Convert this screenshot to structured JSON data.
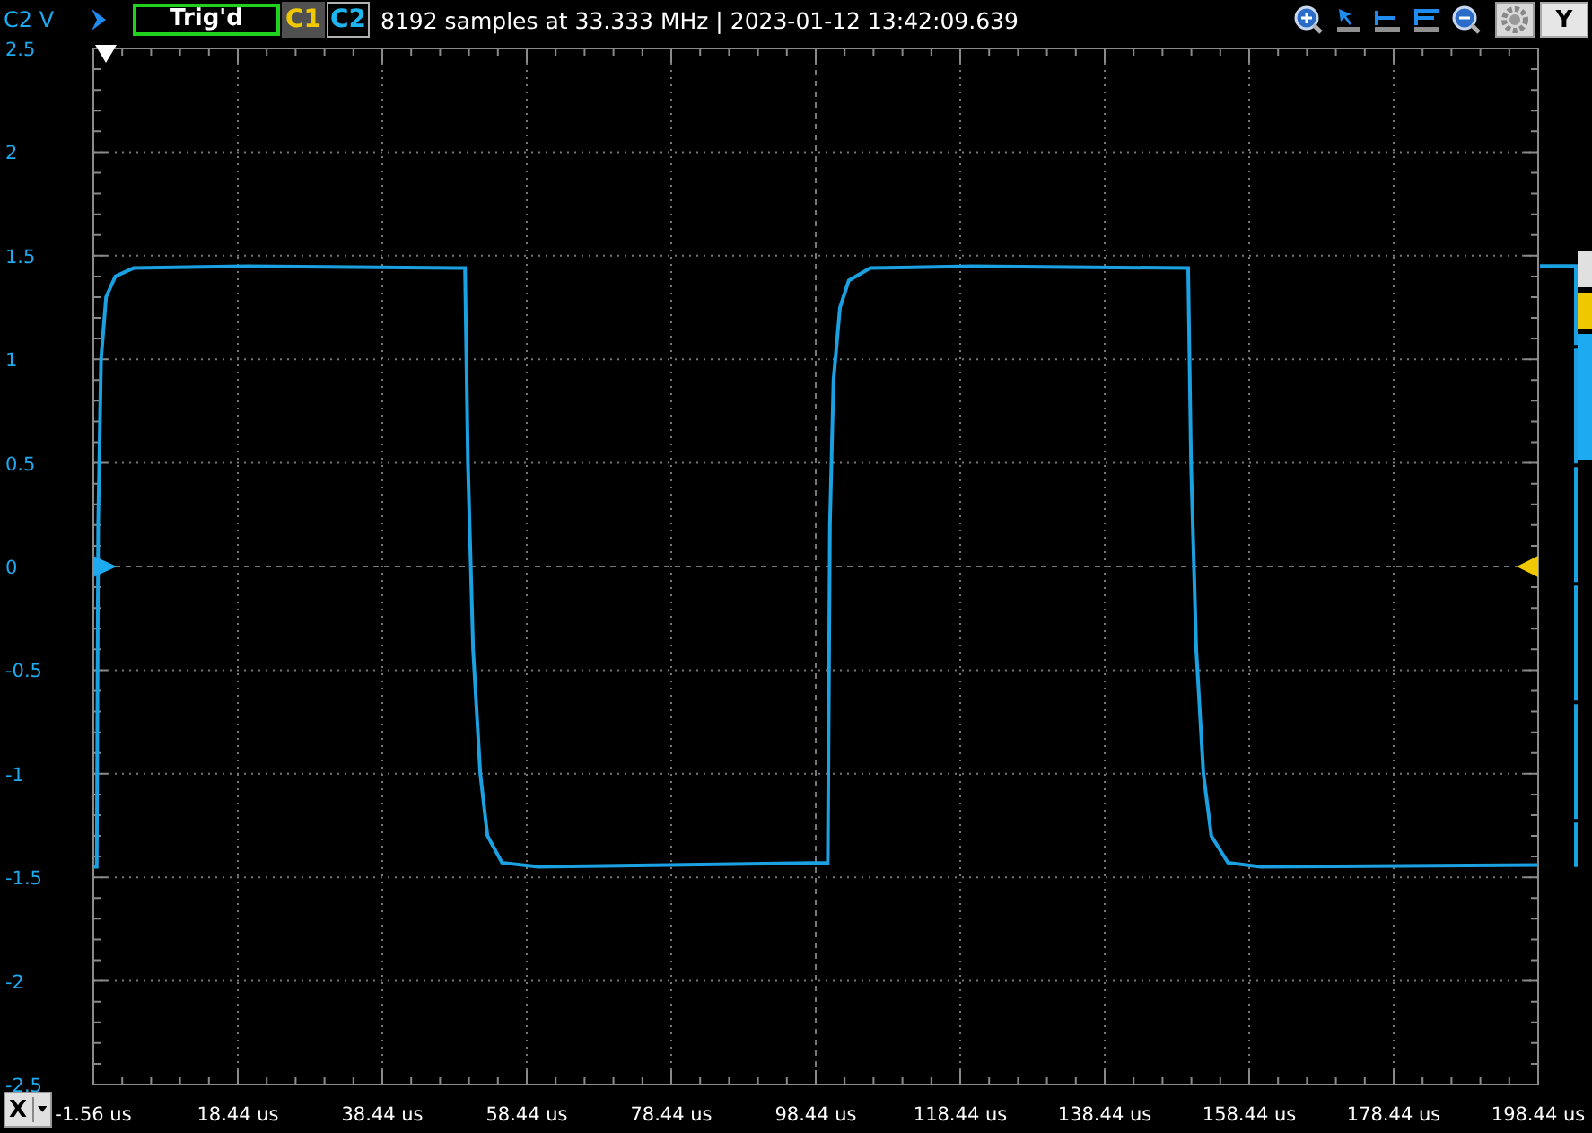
{
  "channel_label": "C2 V",
  "status": "Trig'd",
  "channels": [
    {
      "label": "C1",
      "selected": false,
      "color": "#f0c800"
    },
    {
      "label": "C2",
      "selected": true,
      "color": "#1eb4f0"
    }
  ],
  "info": "8192 samples at 33.333 MHz | 2023-01-12 13:42:09.639",
  "y_button": "Y",
  "x_button": "X",
  "chart_data": {
    "type": "line",
    "grid": true,
    "xlim": [
      -1.56,
      198.44
    ],
    "ylim": [
      -2.5,
      2.5
    ],
    "x": [
      -1.56,
      -1.1,
      -0.9,
      -0.5,
      0.2,
      1.5,
      4,
      20,
      49.9,
      50.3,
      51,
      52,
      53,
      55,
      60,
      100.1,
      100.4,
      100.9,
      101.8,
      103,
      106,
      120,
      150,
      150.4,
      151.1,
      152.1,
      153.2,
      155.5,
      160,
      198.44
    ],
    "series": [
      {
        "color": "#1ba1e2",
        "values": [
          -1.45,
          -1.45,
          0.2,
          1.0,
          1.3,
          1.4,
          1.44,
          1.45,
          1.44,
          0.5,
          -0.4,
          -1.0,
          -1.3,
          -1.43,
          -1.45,
          -1.43,
          0.2,
          0.9,
          1.25,
          1.38,
          1.44,
          1.45,
          1.44,
          0.5,
          -0.4,
          -1.0,
          -1.3,
          -1.43,
          -1.45,
          -1.44
        ]
      }
    ],
    "xticks": [
      {
        "value": -1.56,
        "label": "-1.56 us"
      },
      {
        "value": 18.44,
        "label": "18.44 us"
      },
      {
        "value": 38.44,
        "label": "38.44 us"
      },
      {
        "value": 58.44,
        "label": "58.44 us"
      },
      {
        "value": 78.44,
        "label": "78.44 us"
      },
      {
        "value": 98.44,
        "label": "98.44 us"
      },
      {
        "value": 118.44,
        "label": "118.44 us"
      },
      {
        "value": 138.44,
        "label": "138.44 us"
      },
      {
        "value": 158.44,
        "label": "158.44 us"
      },
      {
        "value": 178.44,
        "label": "178.44 us"
      },
      {
        "value": 198.44,
        "label": "198.44 us"
      }
    ],
    "yticks": [
      2.5,
      2,
      1.5,
      1,
      0.5,
      0,
      -0.5,
      -1,
      -1.5,
      -2,
      -2.5
    ]
  }
}
